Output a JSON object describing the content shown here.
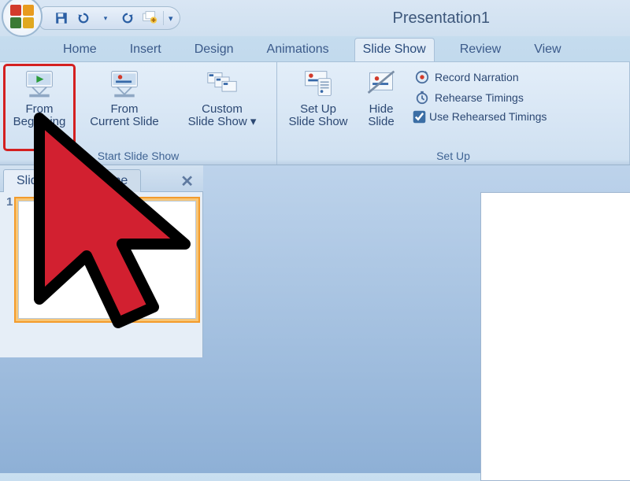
{
  "title": "Presentation1",
  "qat": {
    "save": "save",
    "undo": "undo",
    "redo": "redo",
    "new": "new-slide"
  },
  "tabs": [
    "Home",
    "Insert",
    "Design",
    "Animations",
    "Slide Show",
    "Review",
    "View"
  ],
  "active_tab": "Slide Show",
  "ribbon": {
    "group_start": {
      "label": "Start Slide Show",
      "from_beginning": "From\nBeginning",
      "from_current": "From\nCurrent Slide",
      "custom": "Custom\nSlide Show"
    },
    "group_setup": {
      "label": "Set Up",
      "setup": "Set Up\nSlide Show",
      "hide": "Hide\nSlide",
      "record": "Record Narration",
      "rehearse": "Rehearse Timings",
      "use_rehearsed": "Use Rehearsed Timings",
      "use_rehearsed_checked": true
    }
  },
  "pane": {
    "tab_slides": "Slides",
    "tab_outline": "Outline",
    "slide_index": "1"
  },
  "highlight_target": "from-beginning-button"
}
